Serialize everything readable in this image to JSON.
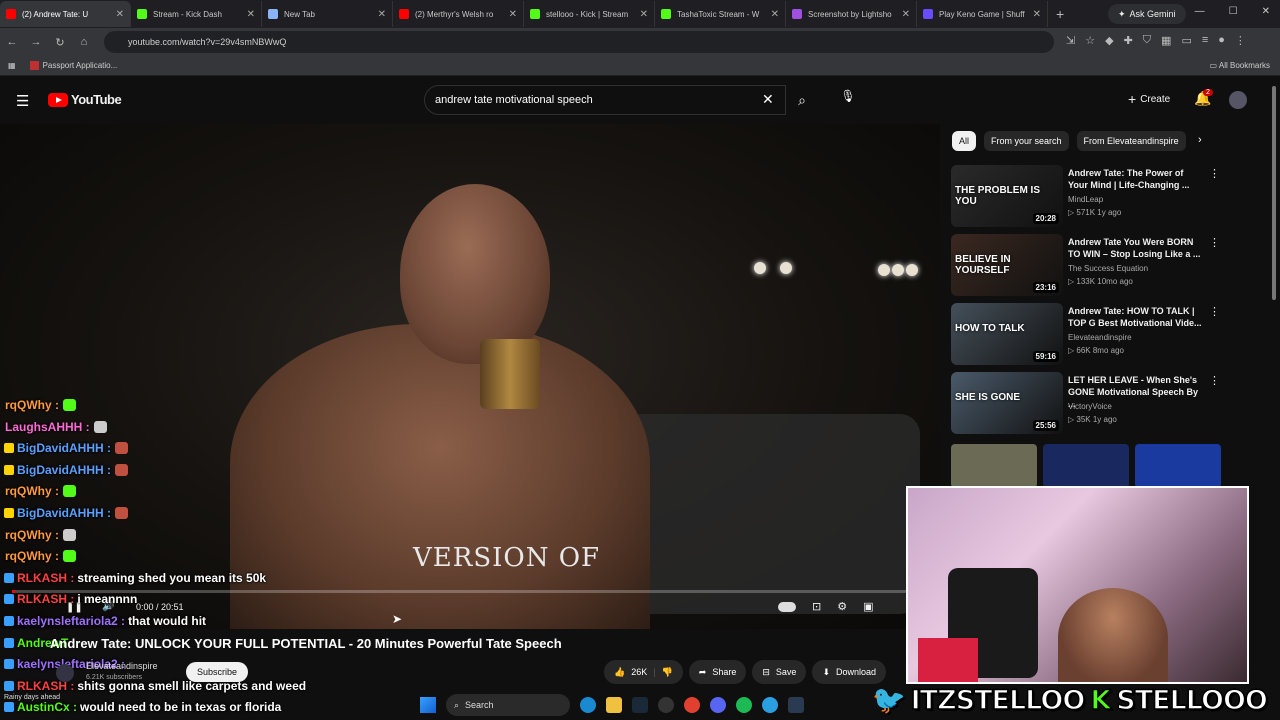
{
  "browser": {
    "tabs": [
      {
        "label": "(2) Andrew Tate: U",
        "color": "#ff0000",
        "active": true
      },
      {
        "label": "Stream - Kick Dash",
        "color": "#53fc18"
      },
      {
        "label": "New Tab",
        "color": "#8ab4f8"
      },
      {
        "label": "(2) Merthyr's Welsh ro",
        "color": "#ff0000"
      },
      {
        "label": "stellooo - Kick | Stream",
        "color": "#53fc18"
      },
      {
        "label": "TashaToxic Stream - W",
        "color": "#53fc18"
      },
      {
        "label": "Screenshot by Lightsho",
        "color": "#a050e0"
      },
      {
        "label": "Play Keno Game | Shuff",
        "color": "#6a4cff"
      }
    ],
    "gemini_label": "Ask Gemini",
    "url": "youtube.com/watch?v=29v4smNBWwQ",
    "bookmark": "Passport Applicatio...",
    "all_bookmarks": "All Bookmarks"
  },
  "youtube": {
    "logo_text": "YouTube",
    "search_query": "andrew tate motivational speech",
    "create_label": "Create",
    "notification_count": "2",
    "video": {
      "caption": "VERSION OF",
      "time": "0:00 / 20:51",
      "progress": 0.003,
      "title": "Andrew Tate: UNLOCK YOUR FULL POTENTIAL - 20 Minutes Powerful Tate Speech",
      "channel": "Elevateandinspire",
      "subscribers": "6.21K subscribers",
      "subscribe_label": "Subscribe",
      "likes": "26K",
      "share_label": "Share",
      "save_label": "Save",
      "download_label": "Download"
    },
    "chips": [
      "All",
      "From your search",
      "From Elevateandinspire"
    ],
    "recommendations": [
      {
        "title": "Andrew Tate: The Power of Your Mind | Life-Changing ...",
        "channel": "MindLeap",
        "meta": "571K  1y ago",
        "duration": "20:28",
        "thumb_text": "THE PROBLEM IS YOU",
        "thumb_color": "#2a2a2a"
      },
      {
        "title": "Andrew Tate You Were BORN TO WIN – Stop Losing Like a ...",
        "channel": "The Success Equation",
        "meta": "133K  10mo ago",
        "duration": "23:16",
        "thumb_text": "BELIEVE IN YOURSELF",
        "thumb_color": "#3a2820"
      },
      {
        "title": "Andrew Tate: HOW TO TALK | TOP G Best Motivational Vide...",
        "channel": "Elevateandinspire",
        "meta": "66K  8mo ago",
        "duration": "59:16",
        "thumb_text": "HOW TO TALK",
        "thumb_color": "#45505a"
      },
      {
        "title": "LET HER LEAVE - When She's GONE Motivational Speech By ...",
        "channel": "VictoryVoice",
        "meta": "35K  1y ago",
        "duration": "25:56",
        "thumb_text": "SHE IS GONE",
        "thumb_color": "#4a5a6a"
      }
    ]
  },
  "chat": [
    {
      "user": "rqQWhy :",
      "msg": "",
      "color": "#ff9a3c",
      "emote": "#53fc18",
      "badge": ""
    },
    {
      "user": "LaughsAHHH :",
      "msg": "",
      "color": "#ff6ad5",
      "emote": "#cccccc",
      "badge": ""
    },
    {
      "user": "BigDavidAHHH :",
      "msg": "",
      "color": "#5aa0ff",
      "emote": "#c05040",
      "badge": "#ffd400"
    },
    {
      "user": "BigDavidAHHH :",
      "msg": "",
      "color": "#5aa0ff",
      "emote": "#c05040",
      "badge": "#ffd400"
    },
    {
      "user": "rqQWhy :",
      "msg": "",
      "color": "#ff9a3c",
      "emote": "#53fc18",
      "badge": ""
    },
    {
      "user": "BigDavidAHHH :",
      "msg": "",
      "color": "#5aa0ff",
      "emote": "#c05040",
      "badge": "#ffd400"
    },
    {
      "user": "rqQWhy :",
      "msg": "",
      "color": "#ff9a3c",
      "emote": "#cccccc",
      "badge": ""
    },
    {
      "user": "rqQWhy :",
      "msg": "",
      "color": "#ff9a3c",
      "emote": "#53fc18",
      "badge": ""
    },
    {
      "user": "RLKASH :",
      "msg": "streaming shed you mean its 50k",
      "color": "#ff4040",
      "emote": "",
      "badge": "#3aa0ff"
    },
    {
      "user": "RLKASH :",
      "msg": "i meannnn",
      "color": "#ff4040",
      "emote": "",
      "badge": "#3aa0ff"
    },
    {
      "user": "kaelynsleftariola2 :",
      "msg": "that would hit",
      "color": "#a070ff",
      "emote": "",
      "badge": "#3aa0ff"
    },
    {
      "user": "AndrewT :",
      "msg": "",
      "color": "#53fc18",
      "emote": "",
      "badge": "#3aa0ff"
    },
    {
      "user": "kaelynsleftariola2 :",
      "msg": "",
      "color": "#a070ff",
      "emote": "",
      "badge": "#3aa0ff"
    },
    {
      "user": "RLKASH :",
      "msg": "shits gonna smell like carpets and weed",
      "color": "#ff4040",
      "emote": "",
      "badge": "#3aa0ff"
    },
    {
      "user": "AustinCx :",
      "msg": "would need to be in texas or florida",
      "color": "#53fc18",
      "emote": "",
      "badge": "#3aa0ff"
    }
  ],
  "overlay": {
    "twitter_handle": "ITZSTELLOO",
    "kick_handle": "STELLOOO"
  },
  "taskbar": {
    "search_label": "Search",
    "weather": "Rainy days ahead"
  }
}
